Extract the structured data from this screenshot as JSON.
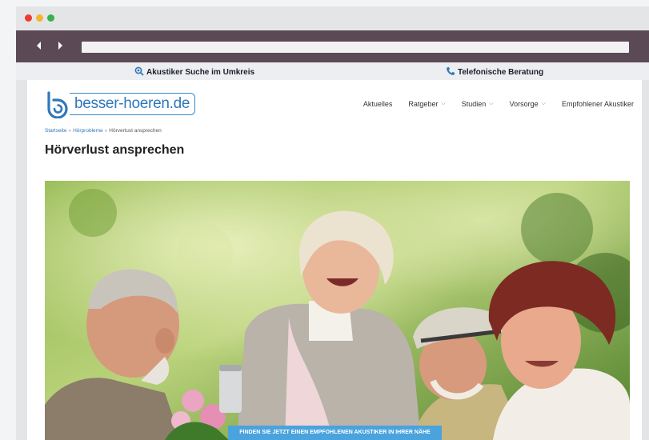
{
  "browser": {
    "dots": [
      "#ee3a2f",
      "#f5b52a",
      "#36b24a"
    ],
    "back_icon": "chevron-left-icon",
    "forward_icon": "chevron-right-icon"
  },
  "topbar": {
    "search_label": "Akustiker Suche im Umkreis",
    "phone_label": "Telefonische Beratung",
    "accent": "#2f78ba"
  },
  "logo": {
    "text": "besser-hoeren.de"
  },
  "nav": {
    "items": [
      {
        "label": "Aktuelles"
      },
      {
        "label": "Ratgeber"
      },
      {
        "label": "Studien"
      },
      {
        "label": "Vorsorge"
      },
      {
        "label": "Empfohlener Akustiker"
      }
    ]
  },
  "breadcrumb": {
    "home": "Startseite",
    "sep": "»",
    "parent": "Hörprobleme",
    "current": "Hörverlust ansprechen"
  },
  "page": {
    "title": "Hörverlust ansprechen",
    "cta_label": "FINDEN SIE JETZT EINEN EMPFOHLENEN AKUSTIKER IN IHRER NÄHE"
  }
}
